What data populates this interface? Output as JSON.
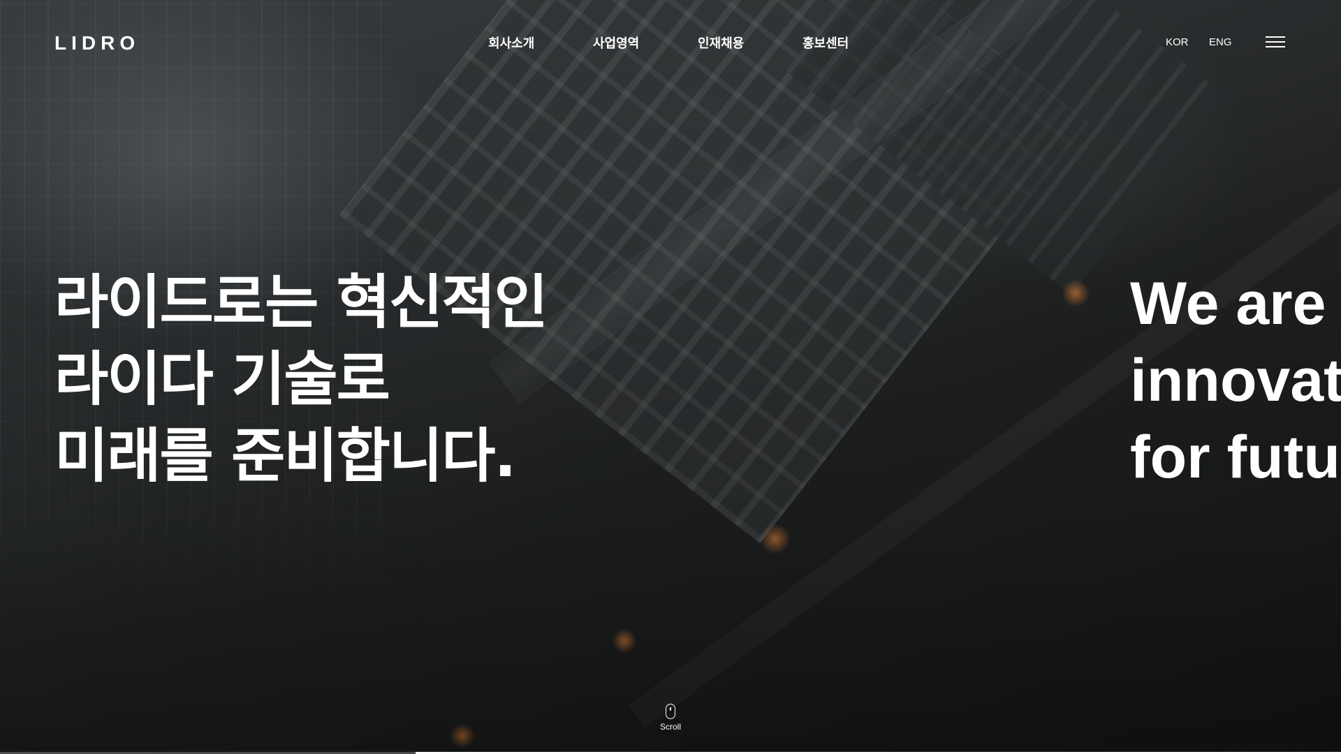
{
  "brand": {
    "logo_text": "LIDRO"
  },
  "nav": {
    "items": [
      {
        "label": "회사소개"
      },
      {
        "label": "사업영역"
      },
      {
        "label": "인재채용"
      },
      {
        "label": "홍보센터"
      }
    ]
  },
  "language": {
    "options": [
      "KOR",
      "ENG"
    ]
  },
  "menu": {
    "icon": "hamburger-menu-icon"
  },
  "hero": {
    "headline_ko": [
      "라이드로는 혁신적인",
      "라이다 기술로",
      "미래를 준비합니다."
    ],
    "headline_en": [
      "We are",
      "innovat",
      "for futu"
    ]
  },
  "scroll": {
    "label": "Scroll",
    "icon": "mouse-icon"
  },
  "slider": {
    "progress": 0.69
  },
  "colors": {
    "text": "#ffffff",
    "overlay": "#1b1b1b"
  }
}
